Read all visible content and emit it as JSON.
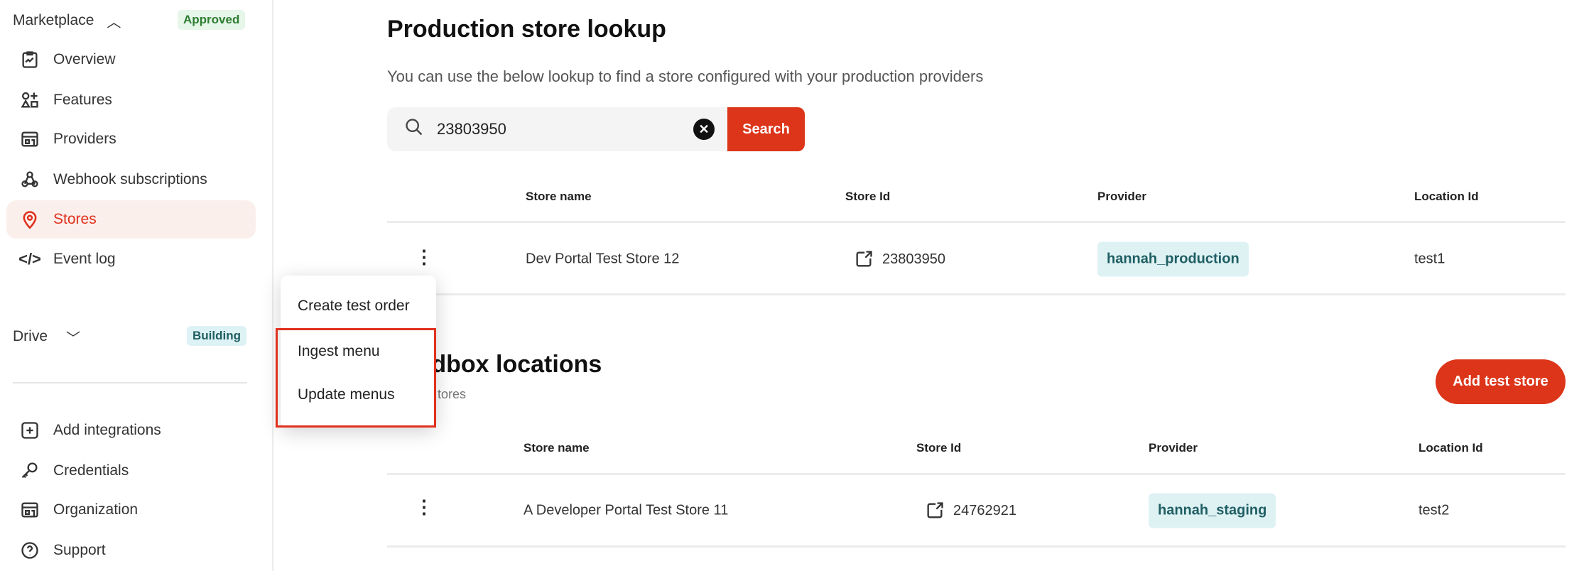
{
  "sidebar": {
    "marketplace": {
      "label": "Marketplace",
      "badge": "Approved"
    },
    "items": [
      {
        "label": "Overview",
        "icon": "clipboard-chart-icon"
      },
      {
        "label": "Features",
        "icon": "shapes-icon"
      },
      {
        "label": "Providers",
        "icon": "storefront-icon"
      },
      {
        "label": "Webhook subscriptions",
        "icon": "webhook-icon"
      },
      {
        "label": "Stores",
        "icon": "location-pin-icon",
        "active": true
      },
      {
        "label": "Event log",
        "icon": "code-icon"
      }
    ],
    "drive": {
      "label": "Drive",
      "badge": "Building"
    },
    "bottom_items": [
      {
        "label": "Add integrations",
        "icon": "plus-square-icon"
      },
      {
        "label": "Credentials",
        "icon": "key-icon"
      },
      {
        "label": "Organization",
        "icon": "building-icon"
      },
      {
        "label": "Support",
        "icon": "help-circle-icon"
      }
    ]
  },
  "production": {
    "title": "Production store lookup",
    "subtitle": "You can use the below lookup to find a store configured with your production providers",
    "search": {
      "value": "23803950",
      "button": "Search"
    },
    "columns": [
      "Store name",
      "Store Id",
      "Provider",
      "Location Id"
    ],
    "rows": [
      {
        "store_name": "Dev Portal Test Store 12",
        "store_id": "23803950",
        "provider": "hannah_production",
        "location_id": "test1"
      }
    ]
  },
  "sandbox": {
    "title": "Sandbox locations",
    "subtitle": "tores",
    "add_button": "Add test store",
    "columns": [
      "Store name",
      "Store Id",
      "Provider",
      "Location Id"
    ],
    "rows": [
      {
        "store_name": "A Developer Portal Test Store 11",
        "store_id": "24762921",
        "provider": "hannah_staging",
        "location_id": "test2"
      }
    ]
  },
  "context_menu": {
    "items": [
      "Create test order",
      "Ingest menu",
      "Update menus"
    ]
  },
  "colors": {
    "accent": "#dc3519",
    "approved_bg": "#e6f6e9",
    "approved_text": "#2e7d32",
    "building_bg": "#ddf2f4",
    "building_text": "#1f5e63"
  }
}
